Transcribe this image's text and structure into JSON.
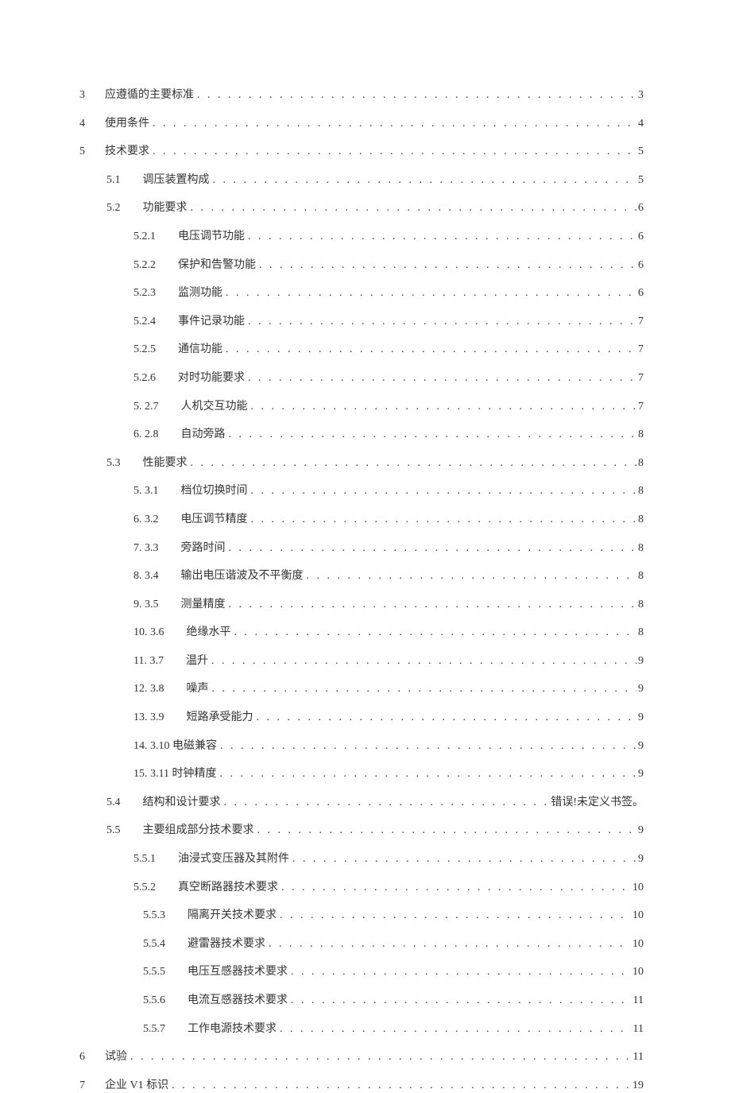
{
  "toc": [
    {
      "level": 0,
      "num": "3",
      "title": "应遵循的主要标准",
      "page": "3"
    },
    {
      "level": 0,
      "num": "4",
      "title": "使用条件",
      "page": "4"
    },
    {
      "level": 0,
      "num": "5",
      "title": "技术要求",
      "page": "5"
    },
    {
      "level": 1,
      "num": "5.1",
      "title": "调压装置构成",
      "page": "5"
    },
    {
      "level": 1,
      "num": "5.2",
      "title": "功能要求",
      "page": "6"
    },
    {
      "level": 2,
      "num": "5.2.1",
      "title": "电压调节功能",
      "page": "6"
    },
    {
      "level": 2,
      "num": "5.2.2",
      "title": "保护和告警功能",
      "page": "6"
    },
    {
      "level": 2,
      "num": "5.2.3",
      "title": "监测功能",
      "page": "6"
    },
    {
      "level": 2,
      "num": "5.2.4",
      "title": "事件记录功能",
      "page": "7"
    },
    {
      "level": 2,
      "num": "5.2.5",
      "title": "通信功能",
      "page": "7"
    },
    {
      "level": 2,
      "num": "5.2.6",
      "title": "对时功能要求",
      "page": "7"
    },
    {
      "level": 2,
      "num": "5.  2.7",
      "title": "人机交互功能",
      "page": "7"
    },
    {
      "level": 2,
      "num": "6.  2.8",
      "title": "自动旁路",
      "page": "8"
    },
    {
      "level": 1,
      "num": "5.3",
      "title": "性能要求",
      "page": "8"
    },
    {
      "level": 2,
      "num": "5.  3.1",
      "title": "档位切换时间",
      "page": "8"
    },
    {
      "level": 2,
      "num": "6.  3.2",
      "title": "电压调节精度",
      "page": "8"
    },
    {
      "level": 2,
      "num": "7.  3.3",
      "title": "旁路时间",
      "page": "8"
    },
    {
      "level": 2,
      "num": "8.  3.4",
      "title": "输出电压谐波及不平衡度",
      "page": "8"
    },
    {
      "level": 2,
      "num": "9.  3.5",
      "title": "测量精度",
      "page": "8"
    },
    {
      "level": 2,
      "num": "10. 3.6",
      "title": "绝缘水平",
      "page": "8"
    },
    {
      "level": 2,
      "num": "11. 3.7",
      "title": "温升",
      "page": "9"
    },
    {
      "level": 2,
      "num": "12. 3.8",
      "title": "噪声",
      "page": "9"
    },
    {
      "level": 2,
      "num": "13. 3.9",
      "title": "短路承受能力",
      "page": "9"
    },
    {
      "level": 2,
      "num": "14. 3.10",
      "title": "电磁兼容",
      "page": "9",
      "inline": true
    },
    {
      "level": 2,
      "num": "15. 3.11",
      "title": "时钟精度",
      "page": "9",
      "inline": true
    },
    {
      "level": 1,
      "num": "5.4",
      "title": "结构和设计要求",
      "page": "错误!未定义书签。"
    },
    {
      "level": 1,
      "num": "5.5",
      "title": "主要组成部分技术要求",
      "page": "9"
    },
    {
      "level": 2,
      "num": "5.5.1",
      "title": "油浸式变压器及其附件",
      "page": "9"
    },
    {
      "level": 2,
      "num": "5.5.2",
      "title": "真空断路器技术要求",
      "page": "10"
    },
    {
      "level": 3,
      "num": "5.5.3",
      "title": "隔离开关技术要求",
      "page": "10"
    },
    {
      "level": 3,
      "num": "5.5.4",
      "title": "避雷器技术要求",
      "page": "10"
    },
    {
      "level": 3,
      "num": "5.5.5",
      "title": "电压互感器技术要求",
      "page": "10"
    },
    {
      "level": 3,
      "num": "5.5.6",
      "title": "电流互感器技术要求",
      "page": "11"
    },
    {
      "level": 3,
      "num": "5.5.7",
      "title": "工作电源技术要求",
      "page": "11"
    },
    {
      "level": 0,
      "num": "6",
      "title": "试验",
      "page": "11"
    },
    {
      "level": 0,
      "num": "7",
      "title": "企业 V1 标识",
      "page": "19"
    }
  ]
}
